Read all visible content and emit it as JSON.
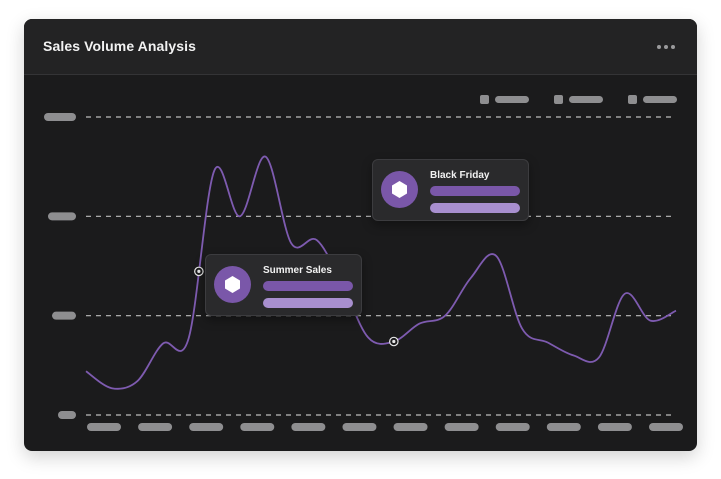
{
  "card": {
    "title": "Sales Volume Analysis",
    "menu_icon": "more-horizontal-icon"
  },
  "colors": {
    "background": "#1b1b1c",
    "header": "#232324",
    "line": "#7e5bb0",
    "accent": "#7a57a9",
    "accent_light": "#a88fcf",
    "placeholder": "#8e8e90",
    "grid": "#d9d9d9"
  },
  "tooltips": [
    {
      "title": "Summer Sales",
      "icon": "hexagon-icon"
    },
    {
      "title": "Black Friday",
      "icon": "hexagon-icon"
    }
  ],
  "chart_data": {
    "type": "line",
    "title": "Sales Volume Analysis",
    "x_tick_count": 12,
    "y_tick_count": 4,
    "legend_entries": 3,
    "legend_placement": "top-right",
    "grid": "horizontal dashed",
    "x": [
      0,
      0.5,
      1,
      1.5,
      2,
      2.5,
      3,
      3.5,
      4,
      4.5,
      5,
      5.5,
      6,
      6.5,
      7,
      7.5,
      8,
      8.5,
      9,
      9.5,
      10,
      10.5,
      11,
      11.5
    ],
    "values": [
      0.44,
      0.27,
      0.34,
      0.72,
      0.77,
      2.46,
      2.0,
      2.6,
      1.73,
      1.76,
      1.31,
      0.78,
      0.74,
      0.92,
      1.0,
      1.38,
      1.6,
      0.87,
      0.73,
      0.6,
      0.58,
      1.22,
      0.95,
      1.05
    ],
    "ylim": [
      0,
      3
    ],
    "annotations": [
      {
        "label": "Summer Sales",
        "x": 2.2
      },
      {
        "label": "Black Friday",
        "x": 6.0
      }
    ]
  }
}
